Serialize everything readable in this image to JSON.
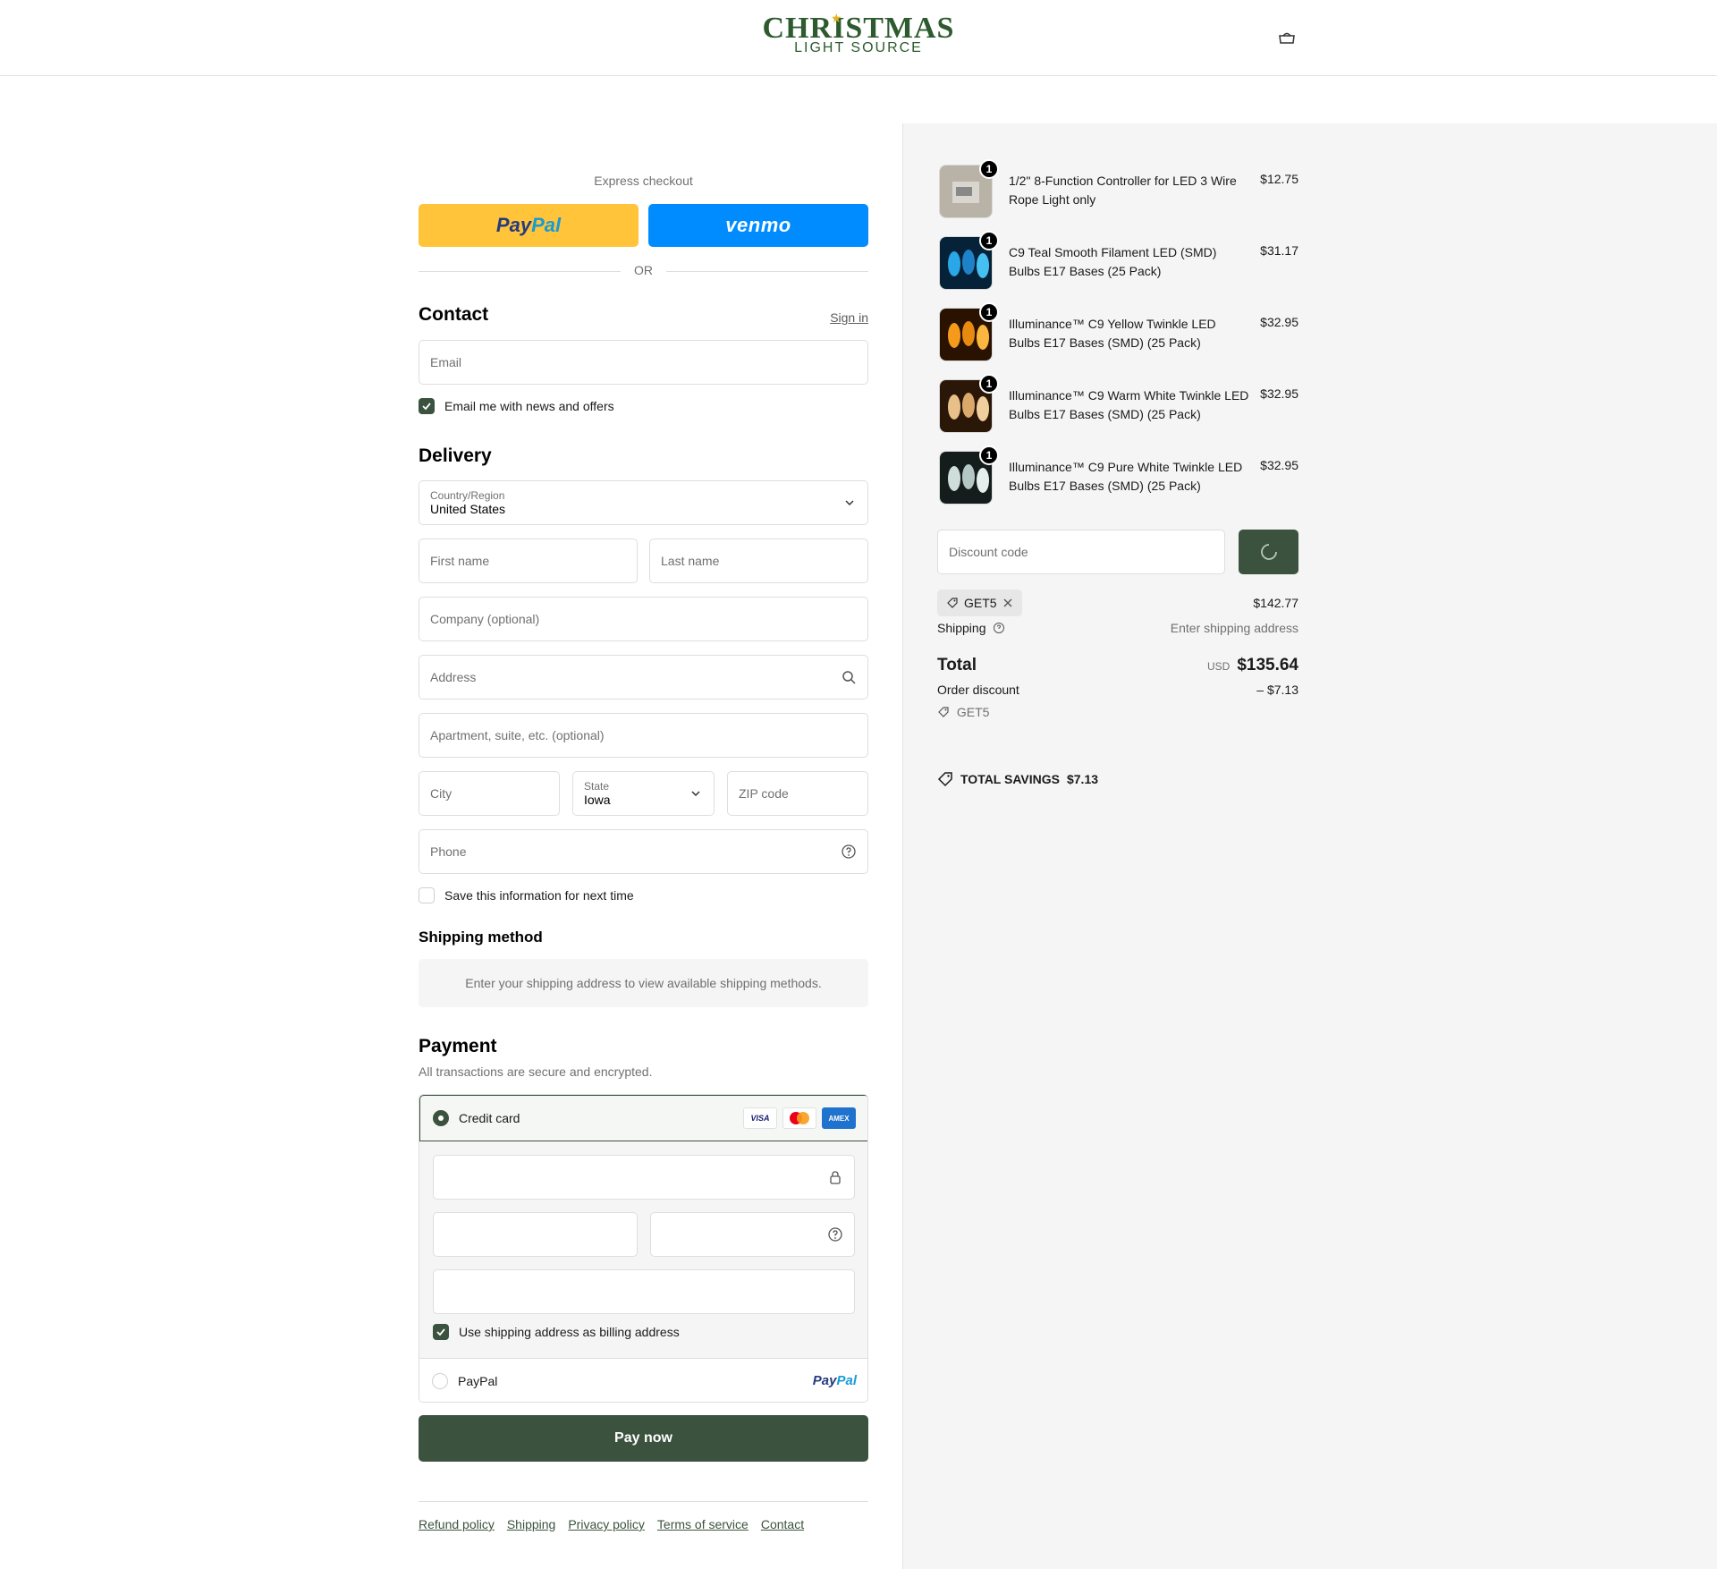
{
  "brand": {
    "name_main": "CHRISTMAS",
    "name_sub": "LIGHT SOURCE"
  },
  "express": {
    "label": "Express checkout",
    "paypal_part1": "Pay",
    "paypal_part2": "Pal",
    "venmo": "venmo",
    "or": "OR"
  },
  "contact": {
    "title": "Contact",
    "sign_in": "Sign in",
    "email_placeholder": "Email",
    "news_label": "Email me with news and offers"
  },
  "delivery": {
    "title": "Delivery",
    "country_label": "Country/Region",
    "country_value": "United States",
    "first_name": "First name",
    "last_name": "Last name",
    "company": "Company (optional)",
    "address": "Address",
    "apartment": "Apartment, suite, etc. (optional)",
    "city": "City",
    "state_label": "State",
    "state_value": "Iowa",
    "zip": "ZIP code",
    "phone": "Phone",
    "save_info": "Save this information for next time"
  },
  "shipping_method": {
    "title": "Shipping method",
    "message": "Enter your shipping address to view available shipping methods."
  },
  "payment": {
    "title": "Payment",
    "subtitle": "All transactions are secure and encrypted.",
    "credit_card": "Credit card",
    "cards": [
      "VISA",
      "MC",
      "AMEX"
    ],
    "billing_label": "Use shipping address as billing address",
    "paypal_label": "PayPal",
    "paypal_logo_1": "Pay",
    "paypal_logo_2": "Pal",
    "pay_now": "Pay now"
  },
  "footer": {
    "links": [
      "Refund policy",
      "Shipping",
      "Privacy policy",
      "Terms of service",
      "Contact"
    ]
  },
  "order": {
    "items": [
      {
        "name": "1/2\" 8-Function Controller for LED 3 Wire Rope Light only",
        "price": "$12.75",
        "qty": "1",
        "color": "#b9b3a7"
      },
      {
        "name": "C9 Teal Smooth Filament LED (SMD) Bulbs E17 Bases (25 Pack)",
        "price": "$31.17",
        "qty": "1",
        "color": "#1e82c8"
      },
      {
        "name": "Illuminance™ C9 Yellow Twinkle LED Bulbs E17 Bases (SMD) (25 Pack)",
        "price": "$32.95",
        "qty": "1",
        "color": "#e88a10"
      },
      {
        "name": "Illuminance™ C9 Warm White Twinkle LED Bulbs E17 Bases (SMD) (25 Pack)",
        "price": "$32.95",
        "qty": "1",
        "color": "#d9a86a"
      },
      {
        "name": "Illuminance™ C9 Pure White Twinkle LED Bulbs E17 Bases (SMD) (25 Pack)",
        "price": "$32.95",
        "qty": "1",
        "color": "#b5c7c4"
      }
    ],
    "discount_placeholder": "Discount code",
    "discount_tag": "GET5",
    "subtotal_value": "$142.77",
    "shipping_label": "Shipping",
    "shipping_value": "Enter shipping address",
    "total_label": "Total",
    "currency": "USD",
    "total_value": "$135.64",
    "order_discount_label": "Order discount",
    "discount_code": "GET5",
    "discount_value": "– $7.13",
    "savings_label": "TOTAL SAVINGS",
    "savings_value": "$7.13"
  },
  "colors": {
    "accent": "#3b523e",
    "paypal_yellow": "#ffc439",
    "venmo_blue": "#008cff"
  }
}
